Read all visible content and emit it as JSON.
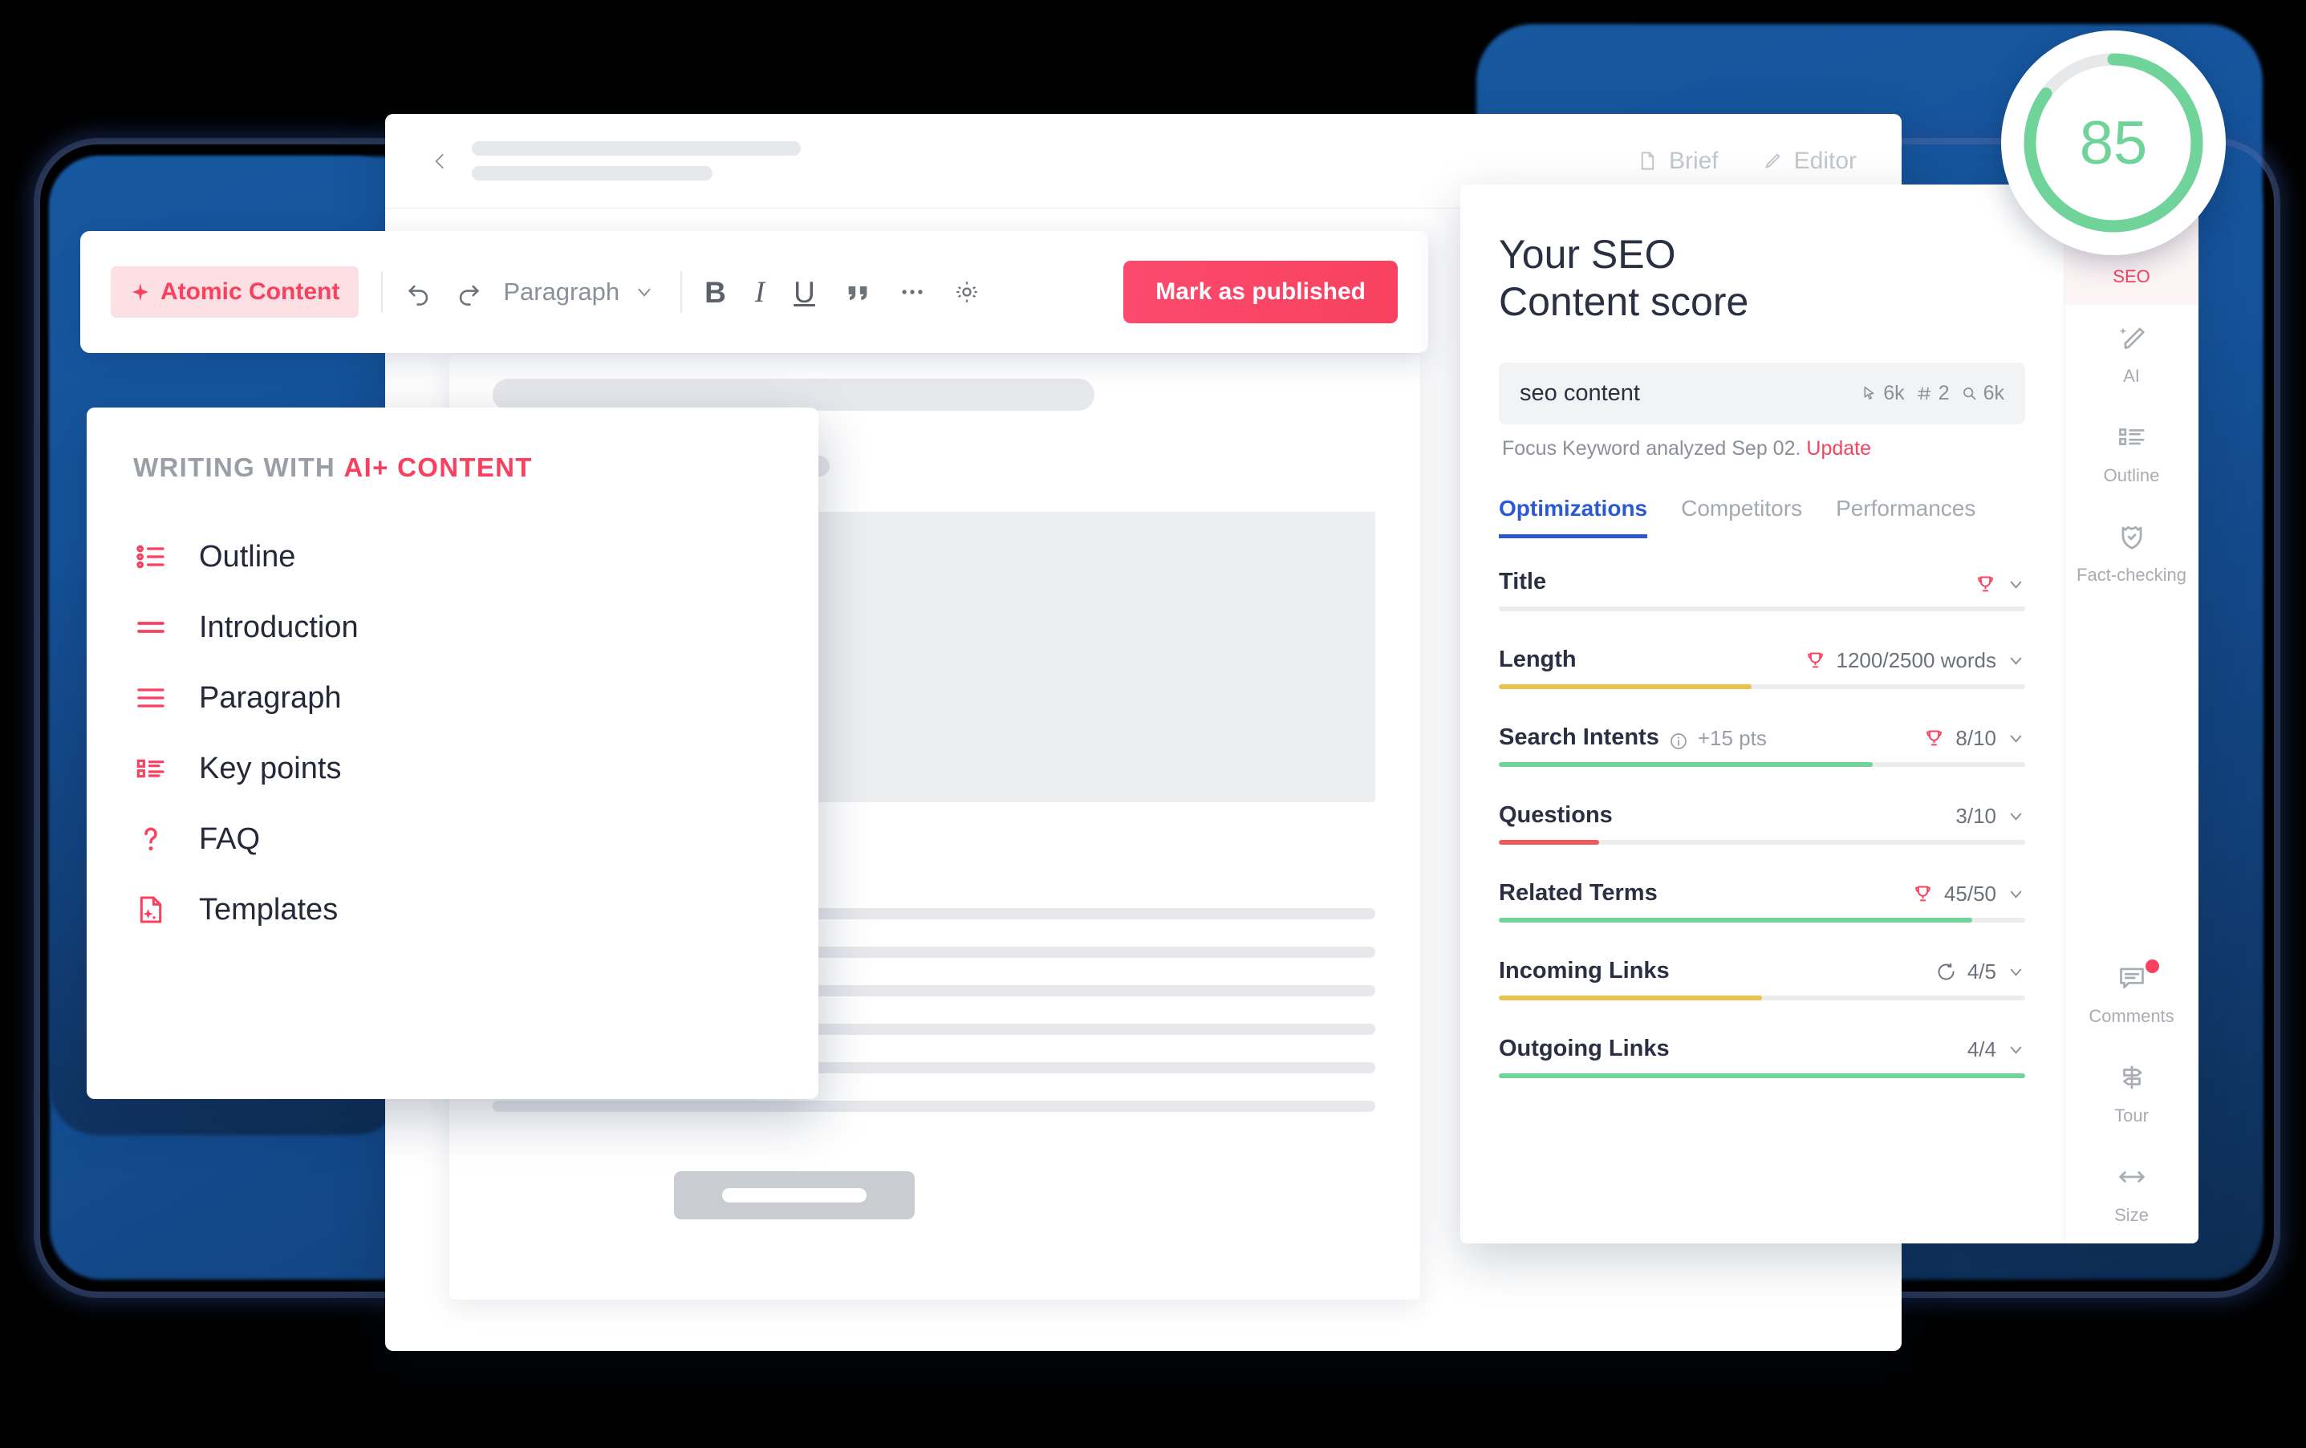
{
  "colors": {
    "accent_pink": "#f8415f",
    "accent_blue": "#2b59d4",
    "backdrop_blue": "#15539b",
    "score_green": "#6fd39a",
    "bar_green": "#6fd39a",
    "bar_yellow": "#eec24a",
    "bar_red": "#f05a5a",
    "bar_track": "#ececee"
  },
  "editor_header": {
    "back_icon": "chevron-left-icon",
    "tabs": [
      {
        "label": "Brief",
        "icon": "document-icon"
      },
      {
        "label": "Editor",
        "icon": "pencil-icon"
      }
    ]
  },
  "toolbar": {
    "atomic_label": "Atomic Content",
    "atomic_icon": "sparkle-icon",
    "undo_icon": "undo-arrow-icon",
    "redo_icon": "redo-arrow-icon",
    "block_style": "Paragraph",
    "block_style_caret": "chevron-down-icon",
    "bold_label": "B",
    "italic_label": "I",
    "underline_label": "U",
    "quote_icon": "quote-icon",
    "more_icon": "ellipsis-icon",
    "settings_icon": "gear-icon",
    "publish_label": "Mark as published"
  },
  "ai_panel": {
    "title_prefix": "WRITING WITH ",
    "title_accent": "AI+ CONTENT",
    "items": [
      {
        "label": "Outline",
        "icon": "bullet-list-icon"
      },
      {
        "label": "Introduction",
        "icon": "two-lines-icon"
      },
      {
        "label": "Paragraph",
        "icon": "three-lines-icon"
      },
      {
        "label": "Key points",
        "icon": "square-bullet-list-icon"
      },
      {
        "label": "FAQ",
        "icon": "question-mark-icon"
      },
      {
        "label": "Templates",
        "icon": "document-sparkle-icon"
      }
    ]
  },
  "seo_panel": {
    "heading_line1": "Your SEO",
    "heading_line2": "Content score",
    "keyword": "seo content",
    "keyword_stats": [
      {
        "icon": "cursor-click-icon",
        "value": "6k"
      },
      {
        "icon": "hash-icon",
        "value": "2"
      },
      {
        "icon": "magnifier-icon",
        "value": "6k"
      }
    ],
    "note_text": "Focus Keyword analyzed Sep 02. ",
    "note_link": "Update",
    "tabs": [
      {
        "label": "Optimizations",
        "active": true
      },
      {
        "label": "Competitors",
        "active": false
      },
      {
        "label": "Performances",
        "active": false
      }
    ],
    "optimizations": [
      {
        "name": "Title",
        "info": false,
        "points": "",
        "trophy": true,
        "refresh": false,
        "value": "",
        "percent": 0,
        "bar_color": "#ececee"
      },
      {
        "name": "Length",
        "info": false,
        "points": "",
        "trophy": true,
        "refresh": false,
        "value": "1200/2500 words",
        "percent": 48,
        "bar_color": "#eec24a"
      },
      {
        "name": "Search Intents",
        "info": true,
        "points": "+15 pts",
        "trophy": true,
        "refresh": false,
        "value": "8/10",
        "percent": 71,
        "bar_color": "#6fd39a"
      },
      {
        "name": "Questions",
        "info": false,
        "points": "",
        "trophy": false,
        "refresh": false,
        "value": "3/10",
        "percent": 19,
        "bar_color": "#f05a5a"
      },
      {
        "name": "Related Terms",
        "info": false,
        "points": "",
        "trophy": true,
        "refresh": false,
        "value": "45/50",
        "percent": 90,
        "bar_color": "#6fd39a"
      },
      {
        "name": "Incoming Links",
        "info": false,
        "points": "",
        "trophy": false,
        "refresh": true,
        "value": "4/5",
        "percent": 50,
        "bar_color": "#eec24a"
      },
      {
        "name": "Outgoing Links",
        "info": false,
        "points": "",
        "trophy": false,
        "refresh": false,
        "value": "4/4",
        "percent": 100,
        "bar_color": "#6fd39a"
      }
    ],
    "rail": [
      {
        "label": "SEO",
        "icon": "speedometer-icon",
        "active": true,
        "badge": false
      },
      {
        "label": "AI",
        "icon": "sparkle-pencil-icon",
        "active": false,
        "badge": false
      },
      {
        "label": "Outline",
        "icon": "outline-list-icon",
        "active": false,
        "badge": false
      },
      {
        "label": "Fact-checking",
        "icon": "shield-check-icon",
        "active": false,
        "badge": false
      },
      {
        "label": "Comments",
        "icon": "comment-icon",
        "active": false,
        "badge": true
      },
      {
        "label": "Tour",
        "icon": "signpost-icon",
        "active": false,
        "badge": false
      },
      {
        "label": "Size",
        "icon": "arrows-horizontal-icon",
        "active": false,
        "badge": false
      }
    ]
  },
  "score_badge": {
    "value": "85",
    "percent": 85
  }
}
